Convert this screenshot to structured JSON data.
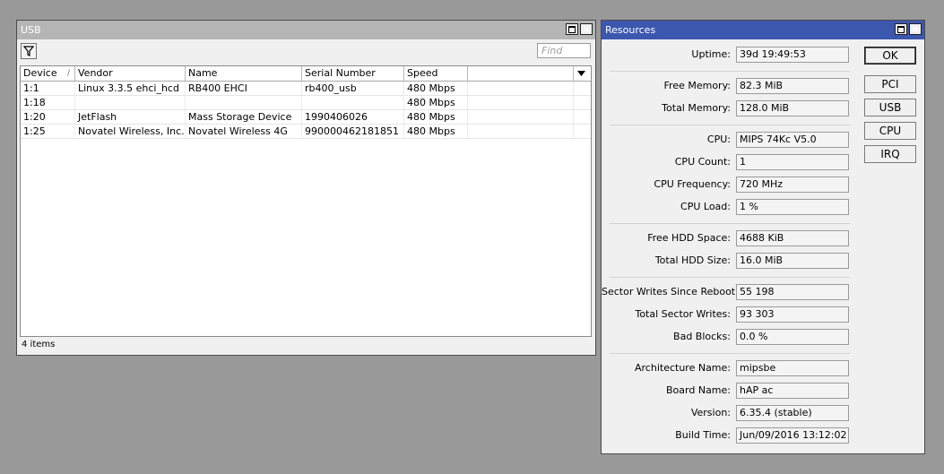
{
  "usb_window": {
    "title": "USB",
    "find_placeholder": "Find",
    "columns": [
      "Device",
      "Vendor",
      "Name",
      "Serial Number",
      "Speed"
    ],
    "sort_indicator": "/",
    "rows": [
      {
        "device": "1:1",
        "vendor": "Linux 3.3.5 ehci_hcd",
        "name": "RB400 EHCI",
        "serial": "rb400_usb",
        "speed": "480 Mbps"
      },
      {
        "device": "1:18",
        "vendor": "",
        "name": "",
        "serial": "",
        "speed": "480 Mbps"
      },
      {
        "device": "1:20",
        "vendor": "JetFlash",
        "name": "Mass Storage Device",
        "serial": "1990406026",
        "speed": "480 Mbps"
      },
      {
        "device": "1:25",
        "vendor": "Novatel Wireless, Inc.",
        "name": "Novatel Wireless 4G",
        "serial": "990000462181851",
        "speed": "480 Mbps"
      }
    ],
    "status": "4 items"
  },
  "resources_window": {
    "title": "Resources",
    "fields": [
      {
        "label": "Uptime:",
        "value": "39d 19:49:53"
      },
      {
        "label": "Free Memory:",
        "value": "82.3 MiB"
      },
      {
        "label": "Total Memory:",
        "value": "128.0 MiB"
      },
      {
        "label": "CPU:",
        "value": "MIPS 74Kc V5.0"
      },
      {
        "label": "CPU Count:",
        "value": "1"
      },
      {
        "label": "CPU Frequency:",
        "value": "720 MHz"
      },
      {
        "label": "CPU Load:",
        "value": "1 %"
      },
      {
        "label": "Free HDD Space:",
        "value": "4688 KiB"
      },
      {
        "label": "Total HDD Size:",
        "value": "16.0 MiB"
      },
      {
        "label": "Sector Writes Since Reboot:",
        "value": "55 198"
      },
      {
        "label": "Total Sector Writes:",
        "value": "93 303"
      },
      {
        "label": "Bad Blocks:",
        "value": "0.0 %"
      },
      {
        "label": "Architecture Name:",
        "value": "mipsbe"
      },
      {
        "label": "Board Name:",
        "value": "hAP ac"
      },
      {
        "label": "Version:",
        "value": "6.35.4 (stable)"
      },
      {
        "label": "Build Time:",
        "value": "Jun/09/2016 13:12:02"
      }
    ],
    "buttons": {
      "ok": "OK",
      "pci": "PCI",
      "usb": "USB",
      "cpu": "CPU",
      "irq": "IRQ"
    }
  },
  "colors": {
    "desktop": "#999999",
    "active_titlebar": "#3c57ae",
    "inactive_titlebar": "#b5b5b5"
  }
}
